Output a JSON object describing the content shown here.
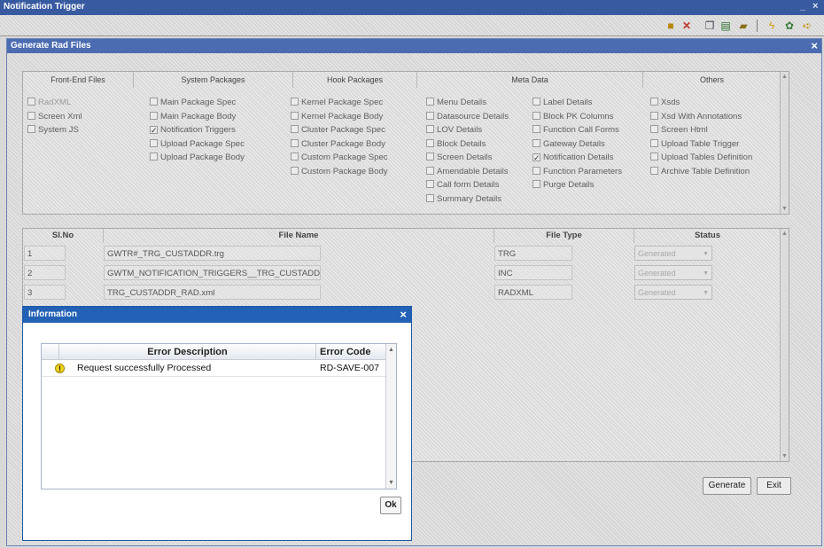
{
  "window": {
    "title": "Notification Trigger",
    "minimize": "_",
    "close": "×"
  },
  "toolbar": {
    "icons": [
      "new-icon",
      "delete-icon",
      "copy-icon",
      "print-icon",
      "folder-icon",
      "lightning-icon",
      "settings-icon",
      "exit-icon"
    ]
  },
  "generate_window": {
    "title": "Generate Rad Files",
    "close": "×"
  },
  "categories": [
    {
      "name": "Front-End Files",
      "items": [
        {
          "label": "RadXML",
          "checked": false,
          "disabled": true
        },
        {
          "label": "Screen Xml",
          "checked": false
        },
        {
          "label": "System JS",
          "checked": false
        }
      ]
    },
    {
      "name": "System Packages",
      "items": [
        {
          "label": "Main Package Spec",
          "checked": false
        },
        {
          "label": "Main Package Body",
          "checked": false
        },
        {
          "label": "Notification Triggers",
          "checked": true
        },
        {
          "label": "Upload Package Spec",
          "checked": false
        },
        {
          "label": "Upload Package Body",
          "checked": false
        }
      ]
    },
    {
      "name": "Hook Packages",
      "items": [
        {
          "label": "Kernel Package Spec",
          "checked": false
        },
        {
          "label": "Kernel Package Body",
          "checked": false
        },
        {
          "label": "Cluster Package Spec",
          "checked": false
        },
        {
          "label": "Cluster Package Body",
          "checked": false
        },
        {
          "label": "Custom Package Spec",
          "checked": false
        },
        {
          "label": "Custom Package Body",
          "checked": false
        }
      ]
    },
    {
      "name": "Meta Data",
      "items": [
        {
          "label": "Menu Details",
          "checked": false
        },
        {
          "label": "Datasource Details",
          "checked": false
        },
        {
          "label": "LOV Details",
          "checked": false
        },
        {
          "label": "Block Details",
          "checked": false
        },
        {
          "label": "Screen Details",
          "checked": false
        },
        {
          "label": "Amendable Details",
          "checked": false
        },
        {
          "label": "Call form Details",
          "checked": false
        },
        {
          "label": "Summary Details",
          "checked": false
        }
      ],
      "items2": [
        {
          "label": "Label Details",
          "checked": false
        },
        {
          "label": "Block PK Columns",
          "checked": false
        },
        {
          "label": "Function Call Forms",
          "checked": false
        },
        {
          "label": "Gateway Details",
          "checked": false
        },
        {
          "label": "Notification Details",
          "checked": true
        },
        {
          "label": "Function Parameters",
          "checked": false
        },
        {
          "label": "Purge Details",
          "checked": false
        }
      ]
    },
    {
      "name": "Others",
      "items": [
        {
          "label": "Xsds",
          "checked": false
        },
        {
          "label": "Xsd With Annotations",
          "checked": false
        },
        {
          "label": "Screen Html",
          "checked": false
        },
        {
          "label": "Upload Table Trigger",
          "checked": false
        },
        {
          "label": "Upload Tables Definition",
          "checked": false
        },
        {
          "label": "Archive Table Definition",
          "checked": false
        }
      ]
    }
  ],
  "grid": {
    "headers": {
      "slno": "Sl.No",
      "file_name": "File Name",
      "file_type": "File Type",
      "status": "Status"
    },
    "rows": [
      {
        "slno": "1",
        "file_name": "GWTR#_TRG_CUSTADDR.trg",
        "file_type": "TRG",
        "status": "Generated"
      },
      {
        "slno": "2",
        "file_name": "GWTM_NOTIFICATION_TRIGGERS__TRG_CUSTADDR.INC",
        "file_type": "INC",
        "status": "Generated"
      },
      {
        "slno": "3",
        "file_name": "TRG_CUSTADDR_RAD.xml",
        "file_type": "RADXML",
        "status": "Generated"
      }
    ]
  },
  "buttons": {
    "generate": "Generate",
    "exit": "Exit"
  },
  "dialog": {
    "title": "Information",
    "close": "×",
    "headers": {
      "description": "Error Description",
      "code": "Error Code"
    },
    "rows": [
      {
        "icon": "warning-icon",
        "description": "Request successfully Processed",
        "code": "RD-SAVE-007"
      }
    ],
    "ok": "Ok"
  }
}
